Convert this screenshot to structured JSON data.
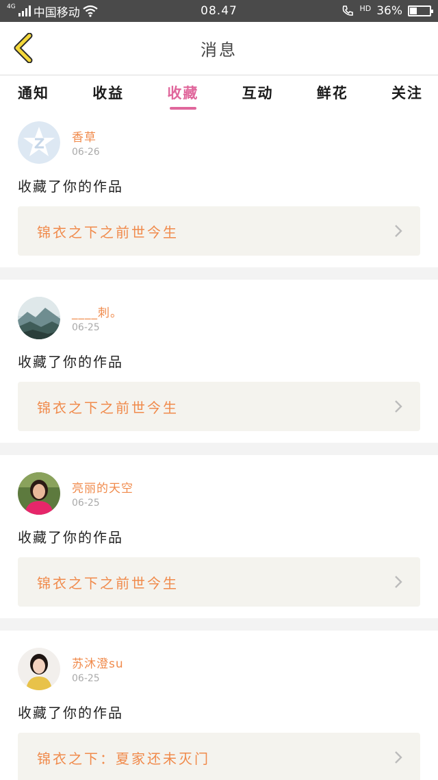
{
  "status_bar": {
    "network": "4G",
    "carrier": "中国移动",
    "time": "08.47",
    "hd": "HD",
    "battery_text": "36%",
    "battery_level": 0.36
  },
  "header": {
    "title": "消息"
  },
  "tabs": [
    {
      "label": "通知",
      "active": false
    },
    {
      "label": "收益",
      "active": false
    },
    {
      "label": "收藏",
      "active": true
    },
    {
      "label": "互动",
      "active": false
    },
    {
      "label": "鲜花",
      "active": false
    },
    {
      "label": "关注",
      "active": false
    }
  ],
  "colors": {
    "accent": "#e0679c",
    "orange": "#f08a4b",
    "status_bar": "#4a4a4a",
    "back_icon": "#f4d83a"
  },
  "messages": [
    {
      "user": "香草",
      "date": "06-26",
      "action": "收藏了你的作品",
      "work": "锦衣之下之前世今生",
      "avatar": "qq-default-avatar"
    },
    {
      "user": "____刺。",
      "date": "06-25",
      "action": "收藏了你的作品",
      "work": "锦衣之下之前世今生",
      "avatar": "landscape-avatar"
    },
    {
      "user": "亮丽的天空",
      "date": "06-25",
      "action": "收藏了你的作品",
      "work": "锦衣之下之前世今生",
      "avatar": "woman-avatar"
    },
    {
      "user": "苏沐澄su",
      "date": "06-25",
      "action": "收藏了你的作品",
      "work": "锦衣之下：夏家还未灭门",
      "avatar": "girl-avatar"
    }
  ]
}
